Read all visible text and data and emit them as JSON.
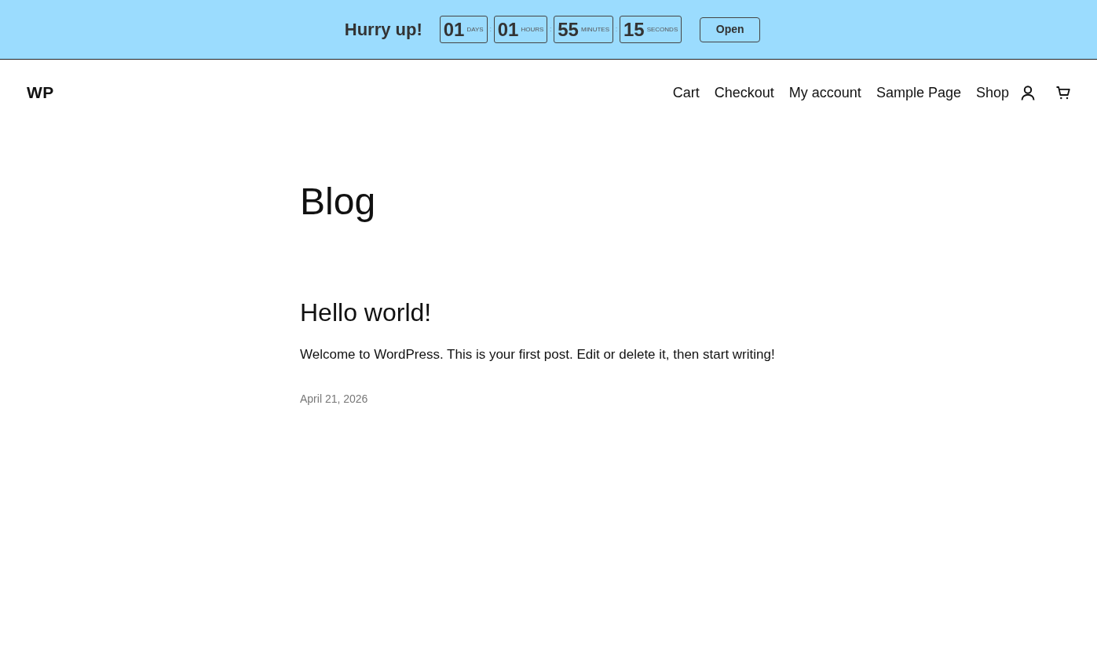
{
  "promo_bar": {
    "headline": "Hurry up!",
    "separator": ":",
    "countdown": [
      {
        "value": "01",
        "unit": "DAYS"
      },
      {
        "value": "01",
        "unit": "HOURS"
      },
      {
        "value": "55",
        "unit": "MINUTES"
      },
      {
        "value": "15",
        "unit": "SECONDS"
      }
    ],
    "button": "Open"
  },
  "header": {
    "logo": "WP",
    "nav": [
      "Cart",
      "Checkout",
      "My account",
      "Sample Page",
      "Shop"
    ]
  },
  "page": {
    "title": "Blog",
    "posts": [
      {
        "title": "Hello world!",
        "excerpt": "Welcome to WordPress. This is your first post. Edit or delete it, then start writing!",
        "date": "April 21, 2026"
      }
    ]
  }
}
